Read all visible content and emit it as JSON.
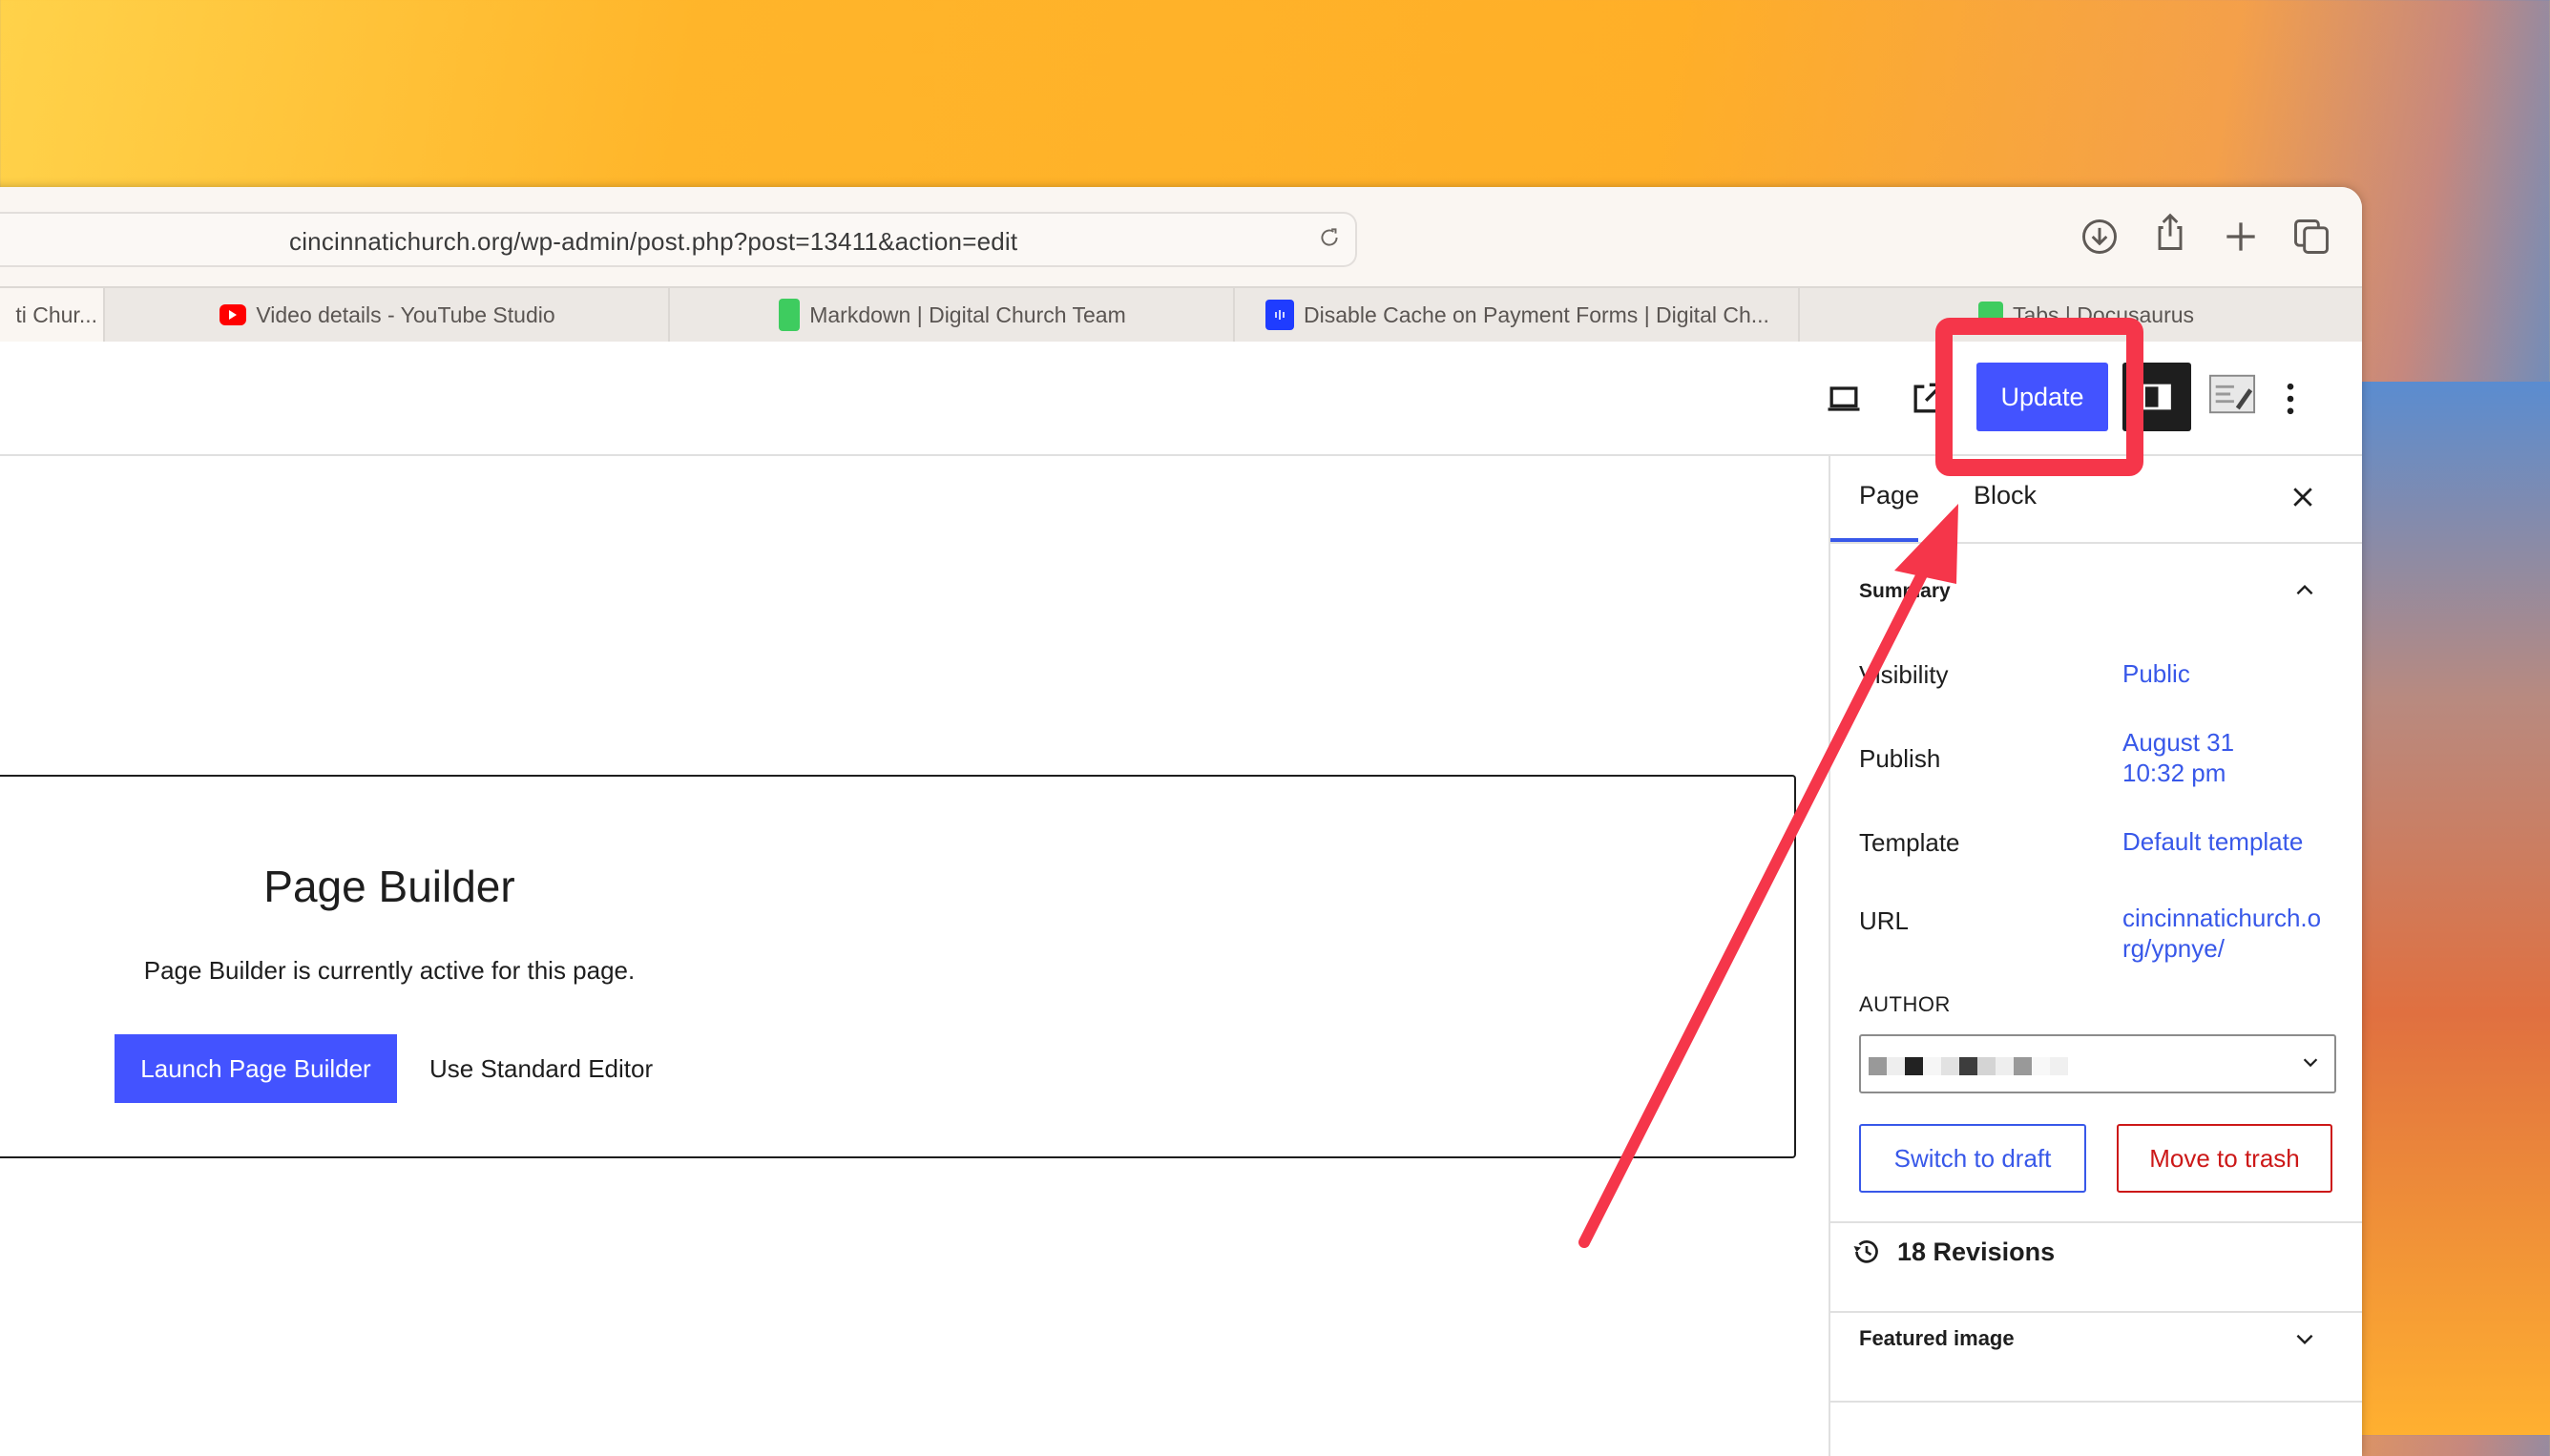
{
  "browser": {
    "url": "cincinnatichurch.org/wp-admin/post.php?post=13411&action=edit",
    "toolbar_icons": [
      "download-icon",
      "share-icon",
      "new-tab-icon",
      "tab-overview-icon"
    ],
    "tabs": [
      {
        "label": "ti Chur...",
        "favicon": "church-icon",
        "active": true
      },
      {
        "label": "Video details - YouTube Studio",
        "favicon": "youtube-icon",
        "color": "#ff0000"
      },
      {
        "label": "Markdown | Digital Church Team",
        "favicon": "docusaurus-icon",
        "color": "#3ecc5f"
      },
      {
        "label": "Disable Cache on Payment Forms | Digital Ch...",
        "favicon": "intercom-icon",
        "color": "#1f3cff"
      },
      {
        "label": "Tabs | Docusaurus",
        "favicon": "docusaurus-icon",
        "color": "#3ecc5f"
      }
    ]
  },
  "editor_header": {
    "update_label": "Update",
    "icons": [
      "preview-icon",
      "view-page-icon",
      "settings-icon",
      "page-builder-icon",
      "more-options-icon"
    ]
  },
  "page_builder": {
    "title": "Page Builder",
    "description": "Page Builder is currently active for this page.",
    "launch_label": "Launch Page Builder",
    "standard_label": "Use Standard Editor"
  },
  "sidebar": {
    "tabs": [
      {
        "label": "Page",
        "active": true
      },
      {
        "label": "Block",
        "active": false
      }
    ],
    "summary_title": "Summary",
    "rows": [
      {
        "label": "Visibility",
        "value": "Public"
      },
      {
        "label": "Publish",
        "value_line1": "August 31",
        "value_line2": "10:32 pm"
      },
      {
        "label": "Template",
        "value": "Default template"
      },
      {
        "label": "URL",
        "value_line1": "cincinnatichurch.o",
        "value_line2": "rg/ypnye/"
      }
    ],
    "author_label": "AUTHOR",
    "author_value": "[redacted]",
    "switch_draft_label": "Switch to draft",
    "trash_label": "Move to trash",
    "revisions_label": "18 Revisions",
    "featured_image_label": "Featured image"
  },
  "annotation": {
    "color": "#f5364a",
    "target": "update-button"
  },
  "colors": {
    "wp_accent": "#4353ff",
    "link_blue": "#3858e9",
    "danger_red": "#cc1818"
  }
}
